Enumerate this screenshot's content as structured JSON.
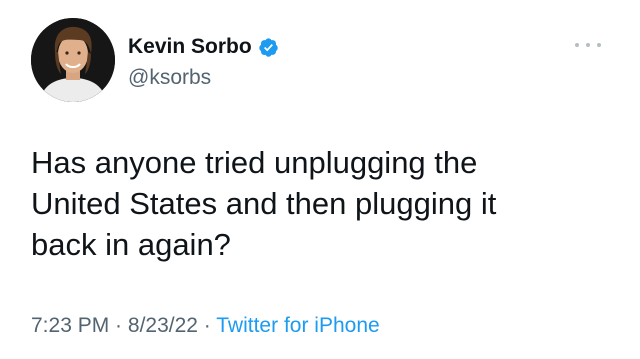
{
  "author": {
    "display_name": "Kevin Sorbo",
    "handle": "@ksorbs",
    "verified": true,
    "avatar_icon": "profile-photo",
    "verified_icon": "verified-badge-icon"
  },
  "more_icon": "more-options-icon",
  "tweet": {
    "lines": [
      "Has anyone tried unplugging the",
      "United States and then plugging it",
      "back in again?"
    ]
  },
  "meta": {
    "time": "7:23 PM",
    "separator": " · ",
    "date": "8/23/22",
    "source": "Twitter for iPhone"
  },
  "colors": {
    "text": "#0f1419",
    "secondary": "#536471",
    "accent": "#1d9bf0",
    "background": "#ffffff"
  }
}
